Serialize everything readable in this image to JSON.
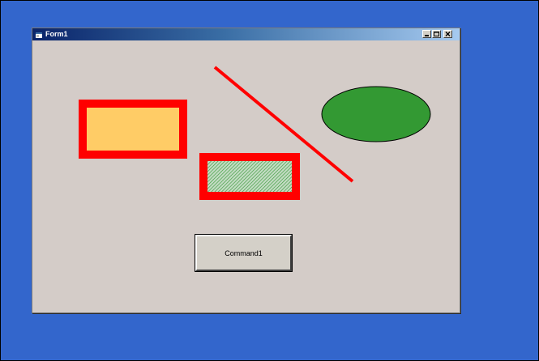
{
  "window": {
    "title": "Form1",
    "caption_buttons": [
      "minimize",
      "maximize",
      "close"
    ]
  },
  "shapes": {
    "rectangle_1": {
      "fill": "#ffcc66",
      "border": "#ff0000"
    },
    "rectangle_2": {
      "fill": "#3a9a3a",
      "fill_style": "hatched",
      "border": "#ff0000"
    },
    "line": {
      "color": "#ff0000"
    },
    "ellipse": {
      "fill": "#339933",
      "border": "#000000"
    }
  },
  "command_button": {
    "label": "Command1"
  },
  "colors": {
    "desktop": "#3366cc",
    "form_background": "#d4ccc8",
    "title_bar": "#0a246a"
  }
}
